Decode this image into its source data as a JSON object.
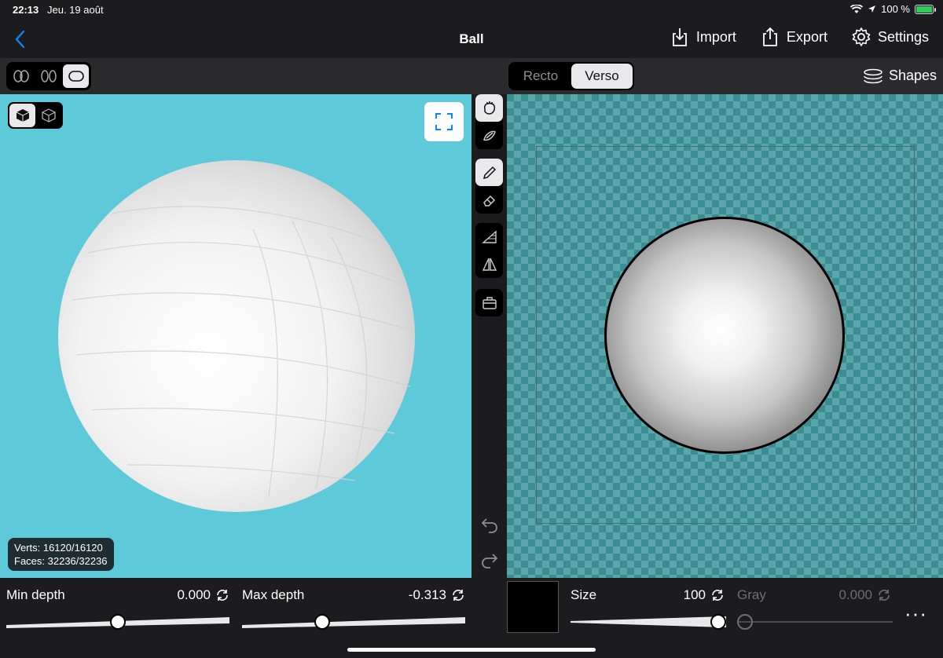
{
  "status": {
    "time": "22:13",
    "date": "Jeu. 19 août",
    "battery": "100 %"
  },
  "nav": {
    "title": "Ball",
    "import_label": "Import",
    "export_label": "Export",
    "settings_label": "Settings"
  },
  "segment": {
    "recto": "Recto",
    "verso": "Verso",
    "selected": "Verso"
  },
  "shapes_label": "Shapes",
  "stats": {
    "verts": "Verts: 16120/16120",
    "faces": "Faces: 32236/32236"
  },
  "controls": {
    "min_depth": {
      "label": "Min depth",
      "value": "0.000",
      "fraction": 0.5
    },
    "max_depth": {
      "label": "Max depth",
      "value": "-0.313",
      "fraction": 0.35
    },
    "size": {
      "label": "Size",
      "value": "100",
      "fraction": 1.0
    },
    "gray": {
      "label": "Gray",
      "value": "0.000",
      "fraction": 0.0
    }
  },
  "colors": {
    "accent": "#0a84ff",
    "viewport_bg": "#5ecad9",
    "swatch": "#000000"
  }
}
